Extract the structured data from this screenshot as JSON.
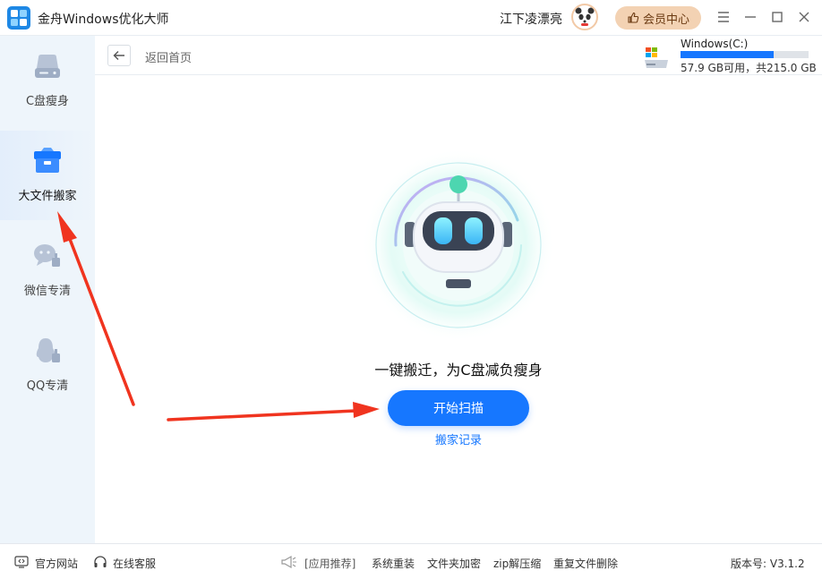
{
  "app": {
    "title": "金舟Windows优化大师"
  },
  "header": {
    "username": "江下凌漂亮",
    "vip_label": "会员中心"
  },
  "sidebar": {
    "items": [
      {
        "label": "C盘瘦身",
        "icon": "disk-icon",
        "active": false
      },
      {
        "label": "大文件搬家",
        "icon": "file-box-icon",
        "active": true
      },
      {
        "label": "微信专清",
        "icon": "wechat-clean-icon",
        "active": false
      },
      {
        "label": "QQ专清",
        "icon": "qq-clean-icon",
        "active": false
      }
    ]
  },
  "subbar": {
    "back_label": "返回首页",
    "drive": {
      "name": "Windows(C:)",
      "info": "57.9 GB可用，共215.0 GB",
      "used_fraction": 0.73
    }
  },
  "main": {
    "tagline": "一键搬迁，为C盘减负瘦身",
    "scan_button": "开始扫描",
    "history_link": "搬家记录"
  },
  "footer": {
    "website": "官方网站",
    "service": "在线客服",
    "recommend": "[应用推荐]",
    "links": [
      "系统重装",
      "文件夹加密",
      "zip解压缩",
      "重复文件删除"
    ],
    "version": "版本号: V3.1.2"
  },
  "colors": {
    "accent": "#1677ff",
    "sidebar_bg": "#eef5fb",
    "vip_bg": "#f3d2b3",
    "annotation_arrow": "#f0341f"
  }
}
